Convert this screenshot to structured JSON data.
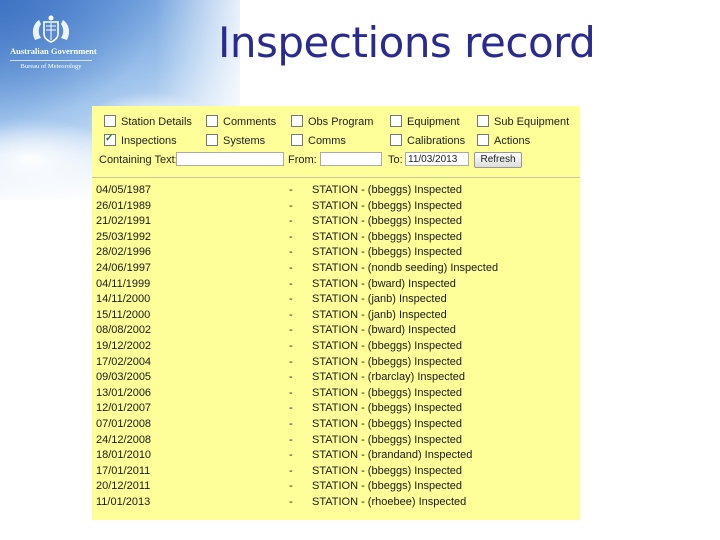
{
  "slide": {
    "title": "Inspections record"
  },
  "logo": {
    "line1": "Australian Government",
    "line2": "Bureau of Meteorology"
  },
  "filters": {
    "checkboxes": [
      {
        "label": "Station Details",
        "checked": false
      },
      {
        "label": "Comments",
        "checked": false
      },
      {
        "label": "Obs Program",
        "checked": false
      },
      {
        "label": "Equipment",
        "checked": false
      },
      {
        "label": "Sub Equipment",
        "checked": false
      },
      {
        "label": "Inspections",
        "checked": true
      },
      {
        "label": "Systems",
        "checked": false
      },
      {
        "label": "Comms",
        "checked": false
      },
      {
        "label": "Calibrations",
        "checked": false
      },
      {
        "label": "Actions",
        "checked": false
      }
    ],
    "containing_text_label": "Containing Text:",
    "containing_text_value": "",
    "from_label": "From:",
    "from_value": "",
    "to_label": "To:",
    "to_value": "11/03/2013",
    "refresh_label": "Refresh"
  },
  "records": [
    {
      "date": "04/05/1987",
      "sep": "-",
      "desc": "STATION - (bbeggs) Inspected"
    },
    {
      "date": "26/01/1989",
      "sep": "-",
      "desc": "STATION - (bbeggs) Inspected"
    },
    {
      "date": "21/02/1991",
      "sep": "-",
      "desc": "STATION - (bbeggs) Inspected"
    },
    {
      "date": "25/03/1992",
      "sep": "-",
      "desc": "STATION - (bbeggs) Inspected"
    },
    {
      "date": "28/02/1996",
      "sep": "-",
      "desc": "STATION - (bbeggs) Inspected"
    },
    {
      "date": "24/06/1997",
      "sep": "-",
      "desc": "STATION - (nondb seeding) Inspected"
    },
    {
      "date": "04/11/1999",
      "sep": "-",
      "desc": "STATION - (bward) Inspected"
    },
    {
      "date": "14/11/2000",
      "sep": "-",
      "desc": "STATION - (janb) Inspected"
    },
    {
      "date": "15/11/2000",
      "sep": "-",
      "desc": "STATION - (janb) Inspected"
    },
    {
      "date": "08/08/2002",
      "sep": "-",
      "desc": "STATION - (bward) Inspected"
    },
    {
      "date": "19/12/2002",
      "sep": "-",
      "desc": "STATION - (bbeggs) Inspected"
    },
    {
      "date": "17/02/2004",
      "sep": "-",
      "desc": "STATION - (bbeggs) Inspected"
    },
    {
      "date": "09/03/2005",
      "sep": "-",
      "desc": "STATION - (rbarclay) Inspected"
    },
    {
      "date": "13/01/2006",
      "sep": "-",
      "desc": "STATION - (bbeggs) Inspected"
    },
    {
      "date": "12/01/2007",
      "sep": "-",
      "desc": "STATION - (bbeggs) Inspected"
    },
    {
      "date": "07/01/2008",
      "sep": "-",
      "desc": "STATION - (bbeggs) Inspected"
    },
    {
      "date": "24/12/2008",
      "sep": "-",
      "desc": "STATION - (bbeggs) Inspected"
    },
    {
      "date": "18/01/2010",
      "sep": "-",
      "desc": "STATION - (brandand) Inspected"
    },
    {
      "date": "17/01/2011",
      "sep": "-",
      "desc": "STATION - (bbeggs) Inspected"
    },
    {
      "date": "20/12/2011",
      "sep": "-",
      "desc": "STATION - (bbeggs) Inspected"
    },
    {
      "date": "11/01/2013",
      "sep": "-",
      "desc": "STATION - (rhoebee) Inspected"
    }
  ]
}
